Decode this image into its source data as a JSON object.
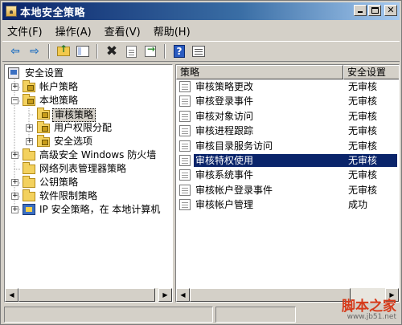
{
  "window": {
    "title": "本地安全策略"
  },
  "menu": [
    "文件(F)",
    "操作(A)",
    "查看(V)",
    "帮助(H)"
  ],
  "toolbar": {
    "icons": [
      "back-arrow-icon",
      "forward-arrow-icon",
      "up-folder-icon",
      "show-tree-icon",
      "delete-icon",
      "properties-icon",
      "export-icon",
      "help-icon",
      "console-view-icon"
    ]
  },
  "tree": {
    "nodes": [
      {
        "label": "安全设置",
        "icon": "computer-icon",
        "indent": 0,
        "expander": ""
      },
      {
        "label": "帐户策略",
        "icon": "lock-folder-icon",
        "indent": 1,
        "expander": "+"
      },
      {
        "label": "本地策略",
        "icon": "lock-folder-icon",
        "indent": 1,
        "expander": "−"
      },
      {
        "label": "审核策略",
        "icon": "lock-folder-icon",
        "indent": 2,
        "expander": "",
        "selected": true
      },
      {
        "label": "用户权限分配",
        "icon": "lock-folder-icon",
        "indent": 2,
        "expander": "+"
      },
      {
        "label": "安全选项",
        "icon": "lock-folder-icon",
        "indent": 2,
        "expander": "+"
      },
      {
        "label": "高级安全 Windows 防火墙",
        "icon": "folder-icon",
        "indent": 1,
        "expander": "+"
      },
      {
        "label": "网络列表管理器策略",
        "icon": "folder-icon",
        "indent": 1,
        "expander": ""
      },
      {
        "label": "公钥策略",
        "icon": "folder-icon",
        "indent": 1,
        "expander": "+"
      },
      {
        "label": "软件限制策略",
        "icon": "folder-icon",
        "indent": 1,
        "expander": "+"
      },
      {
        "label": "IP 安全策略，在 本地计算机",
        "icon": "ipsec-icon",
        "indent": 1,
        "expander": "+"
      }
    ]
  },
  "list": {
    "columns": [
      "策略",
      "安全设置"
    ],
    "rows": [
      {
        "policy": "审核策略更改",
        "setting": "无审核"
      },
      {
        "policy": "审核登录事件",
        "setting": "无审核"
      },
      {
        "policy": "审核对象访问",
        "setting": "无审核"
      },
      {
        "policy": "审核进程跟踪",
        "setting": "无审核"
      },
      {
        "policy": "审核目录服务访问",
        "setting": "无审核"
      },
      {
        "policy": "审核特权使用",
        "setting": "无审核",
        "selected": true
      },
      {
        "policy": "审核系统事件",
        "setting": "无审核"
      },
      {
        "policy": "审核帐户登录事件",
        "setting": "无审核"
      },
      {
        "policy": "审核帐户管理",
        "setting": "成功"
      }
    ]
  },
  "watermark": {
    "main": "脚本之家",
    "url": "www.jb51.net"
  },
  "colors": {
    "title_bar": "#0a246a",
    "selection": "#0a246a",
    "face": "#d4d0c8"
  }
}
